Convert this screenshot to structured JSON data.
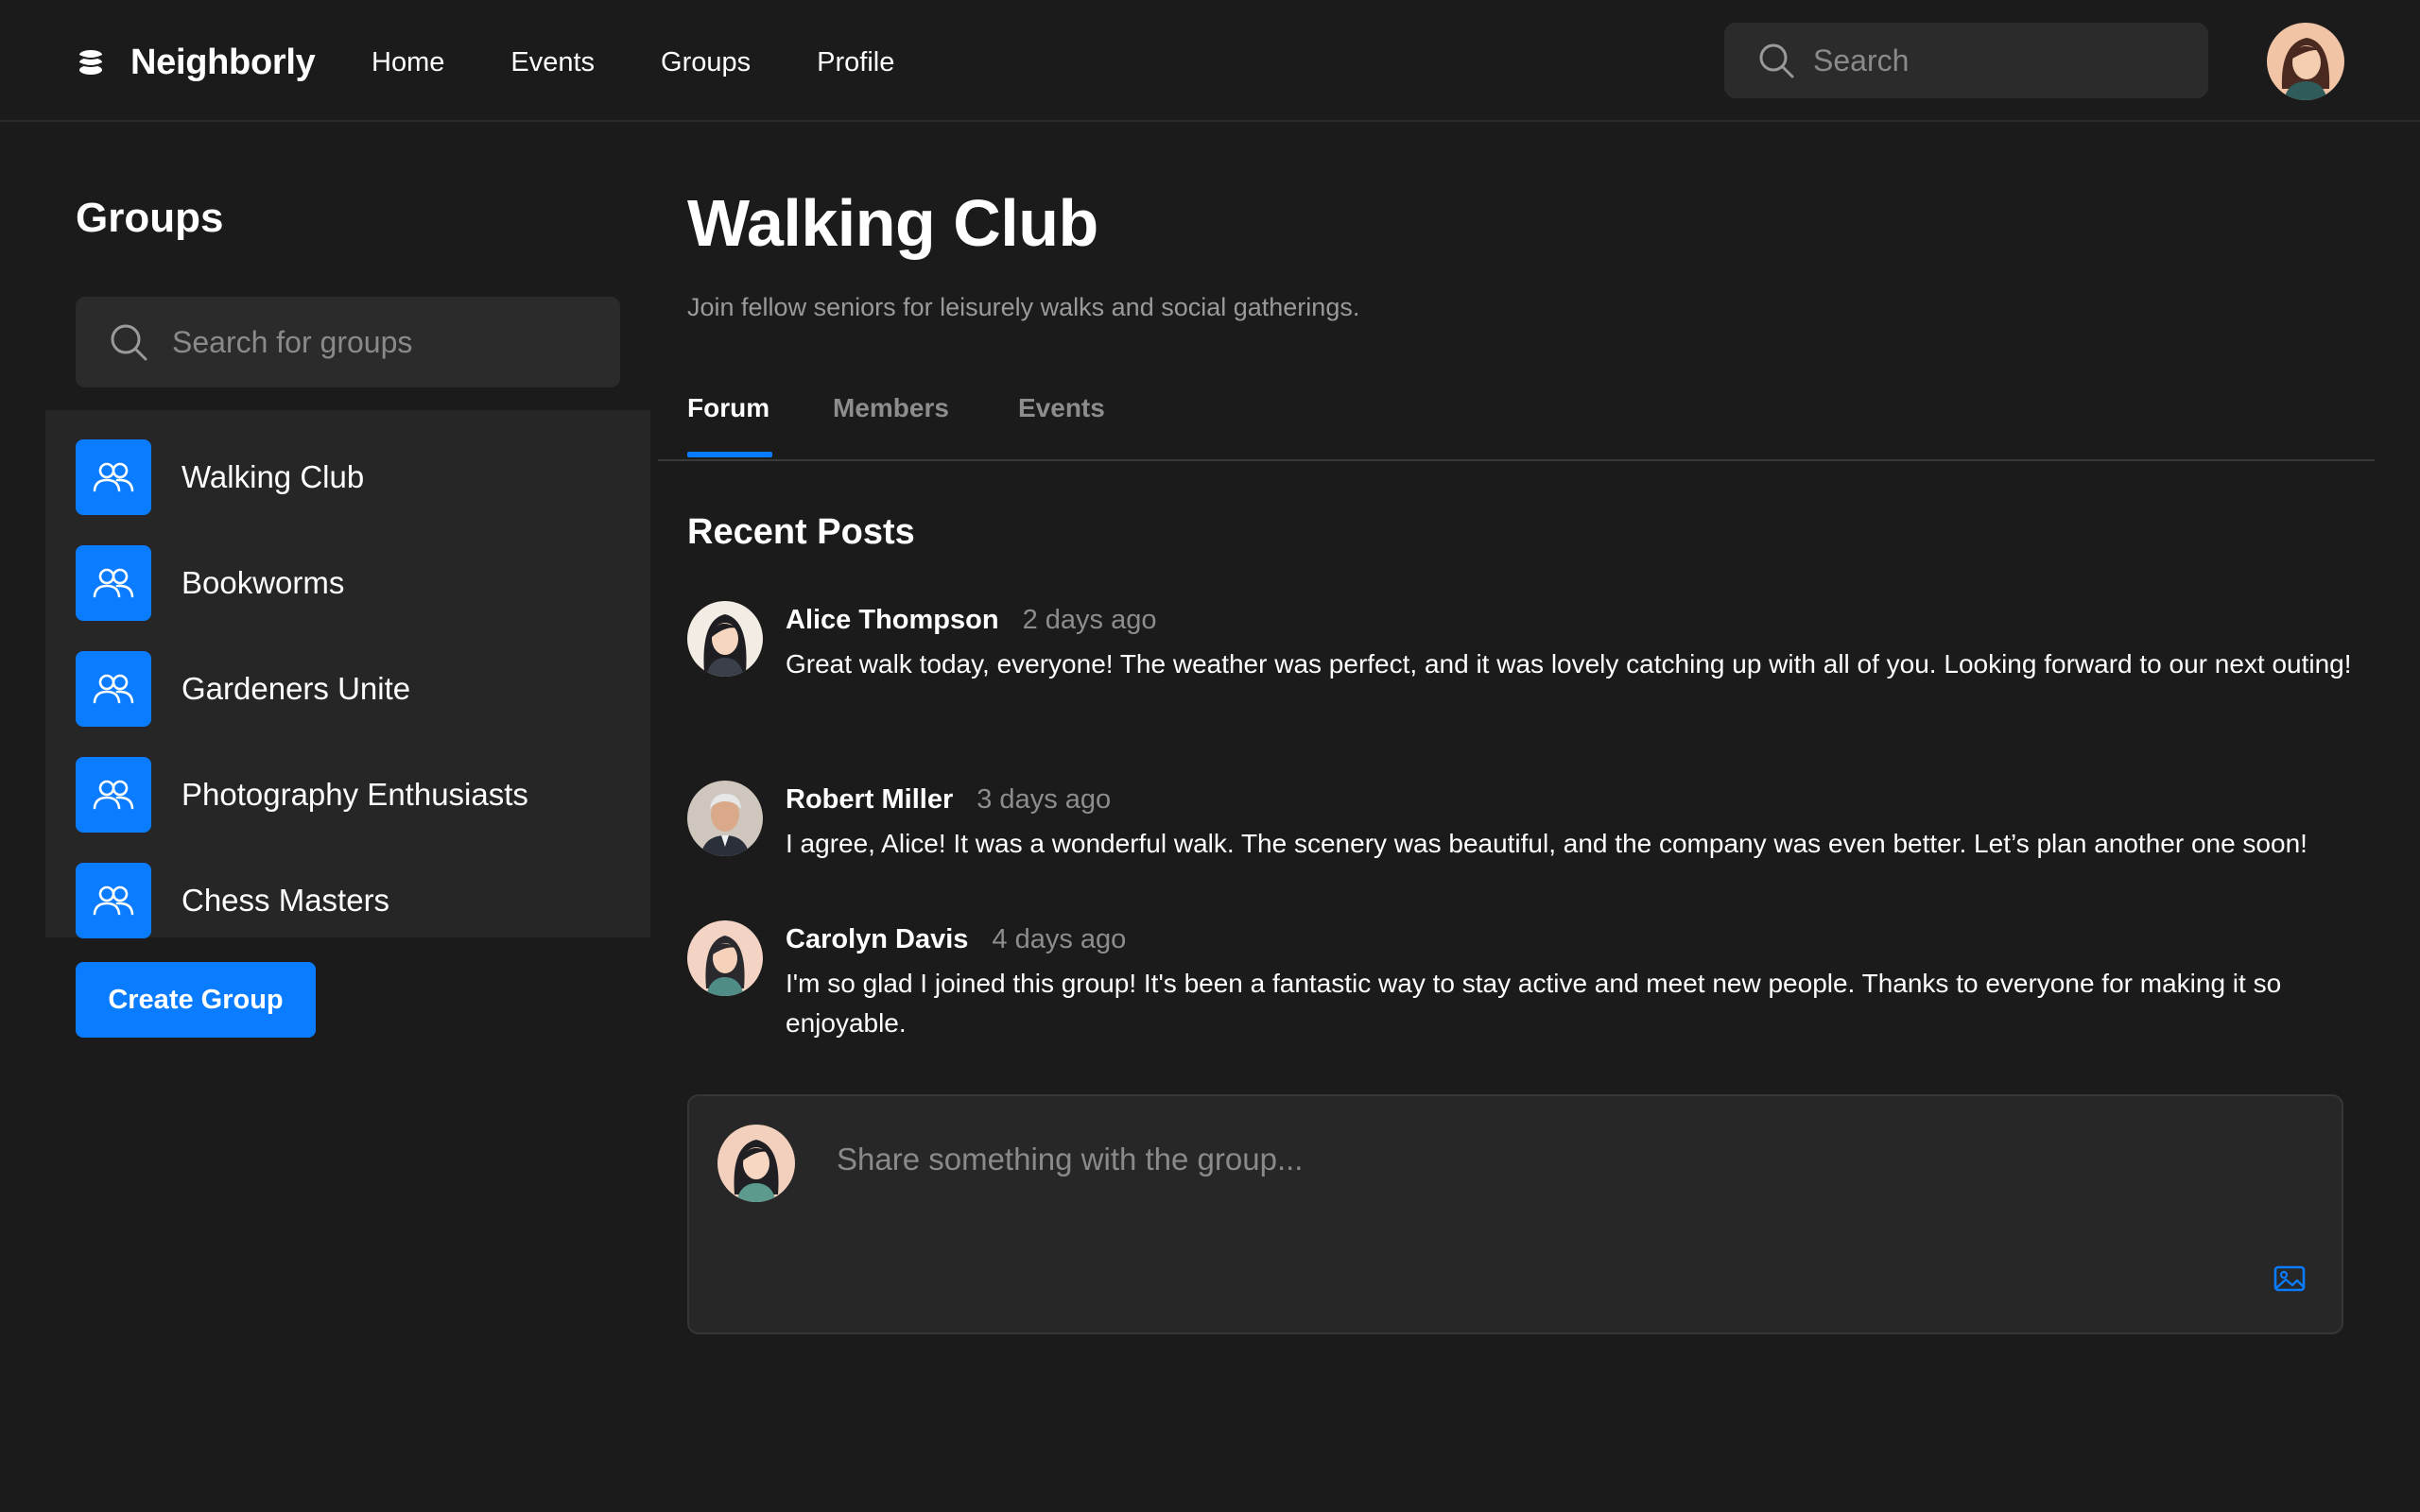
{
  "brand": {
    "name": "Neighborly",
    "logo_icon": "stack-logo-icon"
  },
  "nav": {
    "items": [
      {
        "label": "Home"
      },
      {
        "label": "Events"
      },
      {
        "label": "Groups"
      },
      {
        "label": "Profile"
      }
    ]
  },
  "top_search": {
    "placeholder": "Search",
    "icon": "search-icon"
  },
  "user": {
    "avatar_icon": "avatar-woman-icon"
  },
  "sidebar": {
    "title": "Groups",
    "search_placeholder": "Search for groups",
    "groups": [
      {
        "name": "Walking Club",
        "icon": "users-icon"
      },
      {
        "name": "Bookworms",
        "icon": "users-icon"
      },
      {
        "name": "Gardeners Unite",
        "icon": "users-icon"
      },
      {
        "name": "Photography Enthusiasts",
        "icon": "users-icon"
      },
      {
        "name": "Chess Masters",
        "icon": "users-icon"
      }
    ],
    "create_label": "Create Group"
  },
  "group": {
    "title": "Walking Club",
    "description": "Join fellow seniors for leisurely walks and social gatherings.",
    "tabs": [
      {
        "label": "Forum",
        "active": true
      },
      {
        "label": "Members",
        "active": false
      },
      {
        "label": "Events",
        "active": false
      }
    ]
  },
  "forum": {
    "section_title": "Recent Posts",
    "posts": [
      {
        "author": "Alice Thompson",
        "time": "2 days ago",
        "body": "Great walk today, everyone! The weather was perfect, and it was lovely catching up with all of you. Looking forward to our next outing!"
      },
      {
        "author": "Robert Miller",
        "time": "3 days ago",
        "body": "I agree, Alice! It was a wonderful walk. The scenery was beautiful, and the company was even better. Let’s plan another one soon!"
      },
      {
        "author": "Carolyn Davis",
        "time": "4 days ago",
        "body": "I'm so glad I joined this group! It's been a fantastic way to stay active and meet new people. Thanks to everyone for making it so enjoyable."
      }
    ],
    "composer_placeholder": "Share something with the group...",
    "attach_icon": "image-icon"
  },
  "colors": {
    "background": "#1b1b1b",
    "panel": "#262626",
    "input": "#2b2b2b",
    "accent": "#0a7cff",
    "muted_text": "#8d8d8d"
  }
}
